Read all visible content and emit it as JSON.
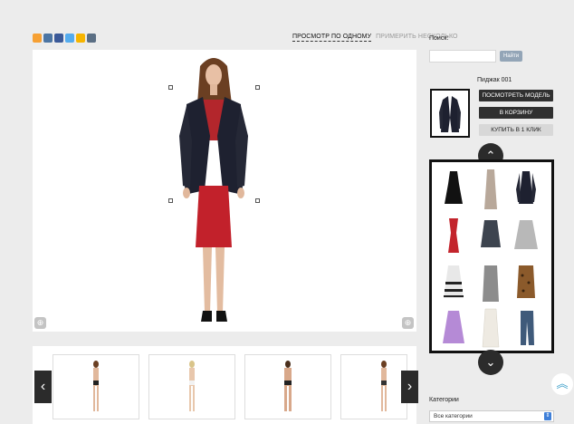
{
  "social_icons": [
    {
      "name": "odnoklassniki-icon",
      "color": "#f6a033"
    },
    {
      "name": "vk-icon",
      "color": "#4c75a3"
    },
    {
      "name": "facebook-icon",
      "color": "#3b5998"
    },
    {
      "name": "twitter-icon",
      "color": "#55acee"
    },
    {
      "name": "mail-icon",
      "color": "#f7b500"
    },
    {
      "name": "livejournal-icon",
      "color": "#5b6f84"
    }
  ],
  "tabs": {
    "view_one": "ПРОСМОТР ПО ОДНОМУ",
    "try_several": "ПРИМЕРИТЬ НЕСКОЛЬКО"
  },
  "search": {
    "label": "Поиск:",
    "placeholder": "",
    "button": "Найти"
  },
  "item": {
    "name": "Пиджак 001",
    "view_model": "ПОСМОТРЕТЬ МОДЕЛЬ",
    "to_cart": "В КОРЗИНУ",
    "buy_one_click": "КУПИТЬ В 1 КЛИК"
  },
  "catalog_items": [
    "black-dress",
    "floral-maxi-dress",
    "black-jacket",
    "red-dress",
    "gray-skirt",
    "light-gray-skirt",
    "striped-skirt",
    "gray-coat",
    "leopard-coat",
    "purple-dress",
    "white-dress",
    "jeans"
  ],
  "models": [
    "model-1",
    "model-2",
    "model-3",
    "model-4"
  ],
  "categories": {
    "label": "Категории",
    "selected": "Все категории"
  },
  "icons": {
    "zoom": "zoom-icon",
    "prev": "chevron-left-icon",
    "next": "chevron-right-icon",
    "up": "chevron-up-icon",
    "down": "chevron-down-icon",
    "top": "scroll-top-icon"
  }
}
